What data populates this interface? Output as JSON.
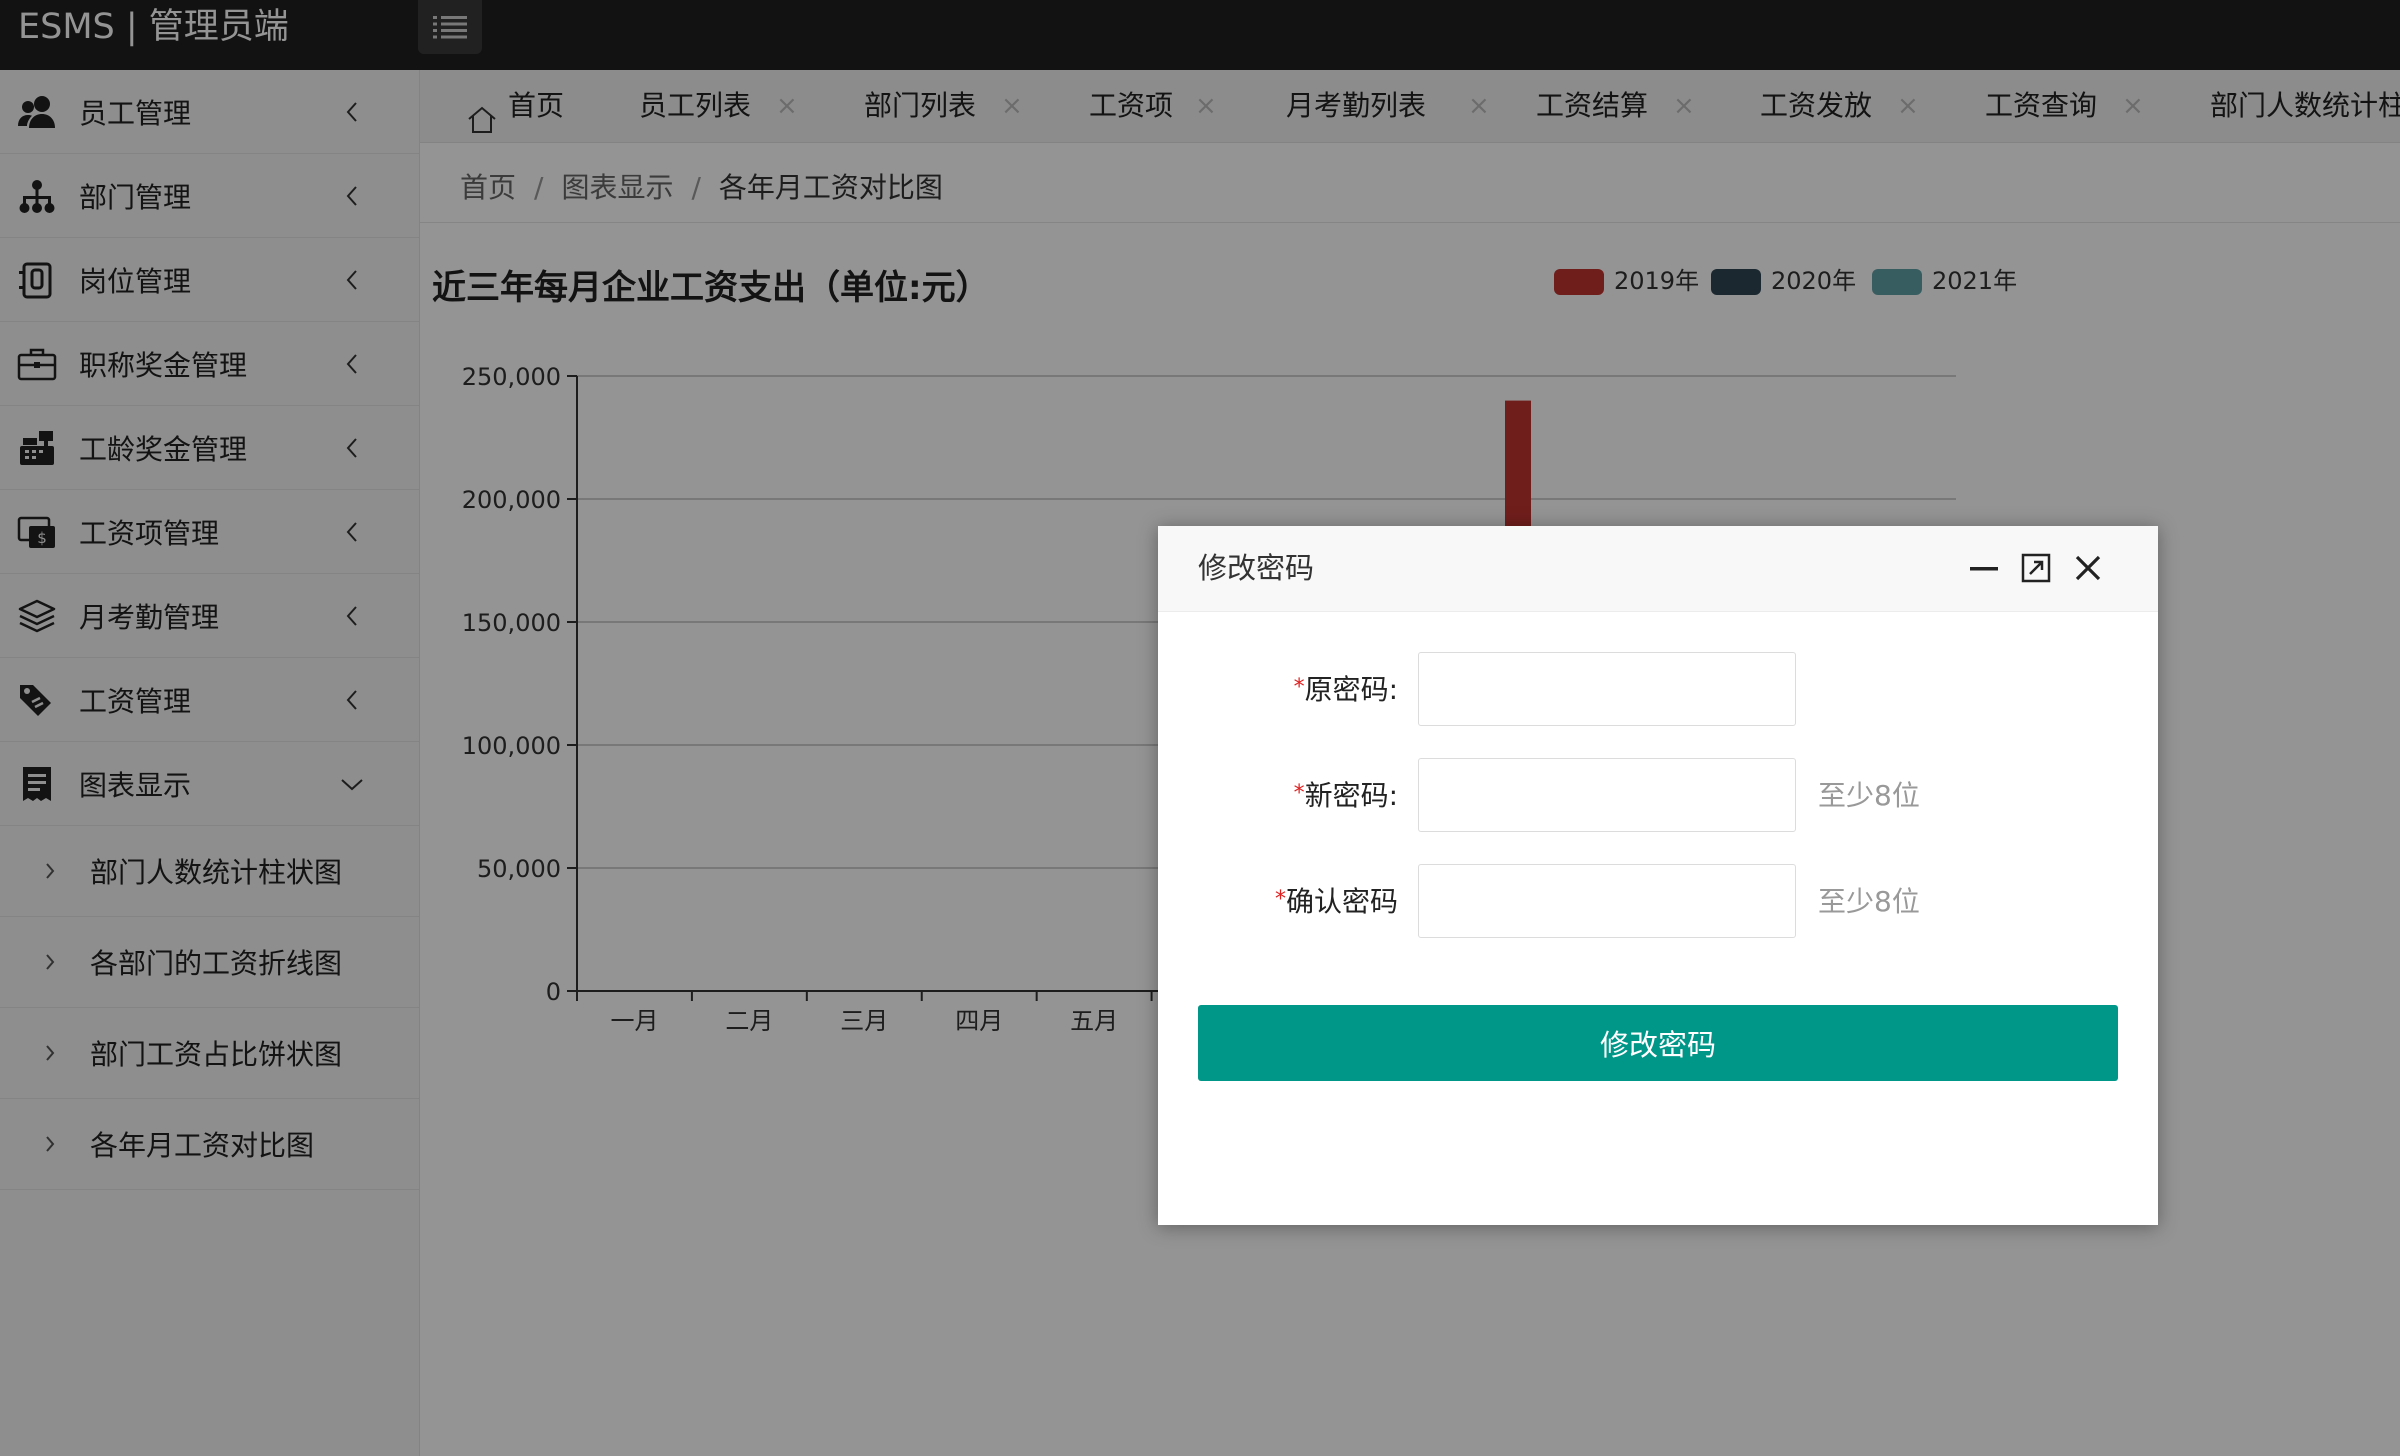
{
  "header": {
    "brand": "ESMS | 管理员端",
    "menu_toggle_icon": "list-icon"
  },
  "sidebar": {
    "items": [
      {
        "label": "员工管理",
        "icon": "user-group-icon",
        "expanded": false
      },
      {
        "label": "部门管理",
        "icon": "org-tree-icon",
        "expanded": false
      },
      {
        "label": "岗位管理",
        "icon": "id-badge-icon",
        "expanded": false
      },
      {
        "label": "职称奖金管理",
        "icon": "briefcase-icon",
        "expanded": false
      },
      {
        "label": "工龄奖金管理",
        "icon": "cash-register-icon",
        "expanded": false
      },
      {
        "label": "工资项管理",
        "icon": "money-bill-icon",
        "expanded": false
      },
      {
        "label": "月考勤管理",
        "icon": "layers-icon",
        "expanded": false
      },
      {
        "label": "工资管理",
        "icon": "tags-icon",
        "expanded": false
      },
      {
        "label": "图表显示",
        "icon": "receipt-icon",
        "expanded": true
      }
    ],
    "sub_items": [
      {
        "label": "部门人数统计柱状图"
      },
      {
        "label": "各部门的工资折线图"
      },
      {
        "label": "部门工资占比饼状图"
      },
      {
        "label": "各年月工资对比图"
      }
    ]
  },
  "tabs": [
    {
      "label": "首页",
      "icon": "home-icon",
      "closable": false
    },
    {
      "label": "员工列表",
      "closable": true
    },
    {
      "label": "部门列表",
      "closable": true
    },
    {
      "label": "工资项",
      "closable": true
    },
    {
      "label": "月考勤列表",
      "closable": true
    },
    {
      "label": "工资结算",
      "closable": true
    },
    {
      "label": "工资发放",
      "closable": true
    },
    {
      "label": "工资查询",
      "closable": true
    },
    {
      "label": "部门人数统计柱"
    }
  ],
  "tab_close_glyph": "×",
  "breadcrumb": {
    "items": [
      "首页",
      "图表显示",
      "各年月工资对比图"
    ],
    "separator": "/"
  },
  "chart_data": {
    "type": "bar",
    "title": "近三年每月企业工资支出（单位:元）",
    "categories": [
      "一月",
      "二月",
      "三月",
      "四月",
      "五月",
      "",
      "",
      "",
      "",
      "",
      "",
      ""
    ],
    "series": [
      {
        "name": "2019年",
        "color": "#c23531",
        "values": [
          0,
          0,
          0,
          0,
          0,
          null,
          null,
          null,
          null,
          null,
          null,
          null
        ]
      },
      {
        "name": "2020年",
        "color": "#2f4554",
        "values": [
          0,
          0,
          0,
          0,
          0,
          null,
          null,
          null,
          null,
          null,
          null,
          null
        ]
      },
      {
        "name": "2021年",
        "color": "#61a0a8",
        "values": [
          0,
          0,
          0,
          0,
          0,
          null,
          null,
          null,
          null,
          null,
          null,
          null
        ]
      }
    ],
    "visible_bar": {
      "series": "2019年",
      "value": 240000
    },
    "ylim": [
      0,
      250000
    ],
    "yticks": [
      0,
      50000,
      100000,
      150000,
      200000,
      250000
    ],
    "ytick_labels": [
      "0",
      "50,000",
      "100,000",
      "150,000",
      "200,000",
      "250,000"
    ],
    "grid": true,
    "legend": "top-right"
  },
  "dialog": {
    "title": "修改密码",
    "fields": [
      {
        "label": "原密码:",
        "required": true,
        "value": "",
        "hint": ""
      },
      {
        "label": "新密码:",
        "required": true,
        "value": "",
        "hint": "至少8位"
      },
      {
        "label": "确认密码",
        "required": true,
        "value": "",
        "hint": "至少8位"
      }
    ],
    "required_mark": "*",
    "submit_label": "修改密码",
    "controls": [
      "minimize-icon",
      "maximize-icon",
      "close-icon"
    ]
  },
  "colors": {
    "topbar": "#1f1f1f",
    "accent": "#009688",
    "required": "#e02020"
  }
}
